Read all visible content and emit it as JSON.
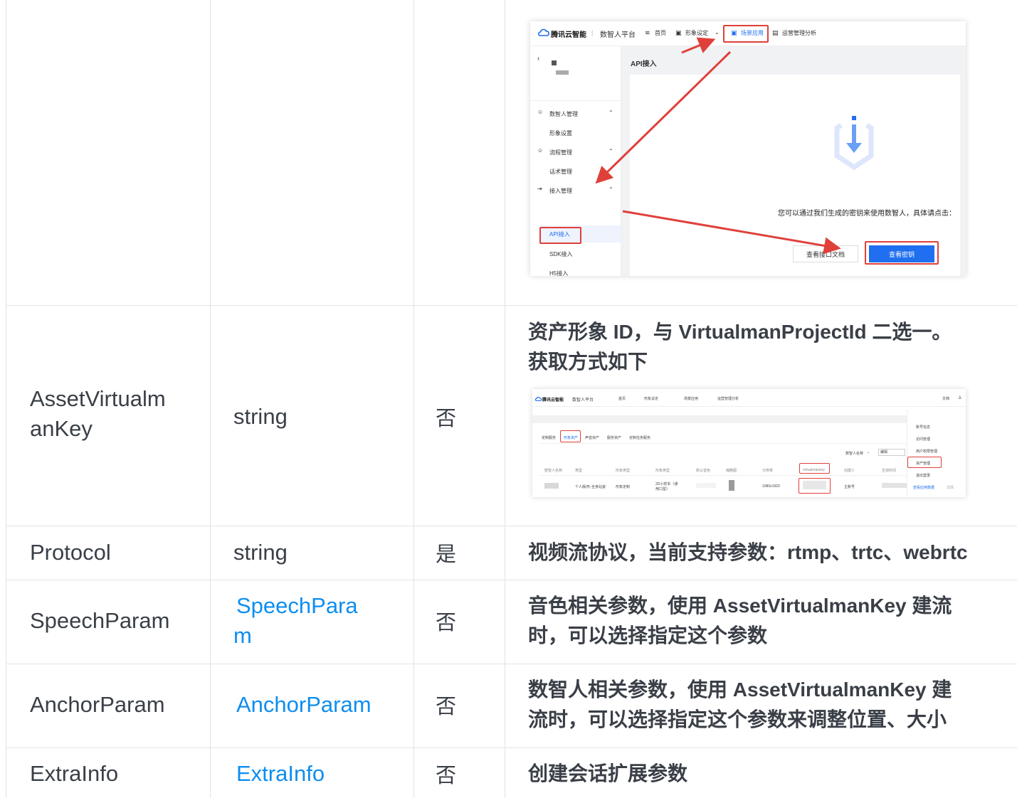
{
  "table": {
    "rows": [
      {
        "name_lines": [
          "AssetVirtualm",
          "anKey"
        ],
        "type": "string",
        "required": "否",
        "desc_lines": [
          "资产形象 ID，与 VirtualmanProjectId 二选一。",
          "获取方式如下"
        ]
      },
      {
        "name": "Protocol",
        "type": "string",
        "required": "是",
        "desc": "视频流协议，当前支持参数：rtmp、trtc、webrtc"
      },
      {
        "name": "SpeechParam",
        "type_lines": [
          "SpeechPara",
          "m"
        ],
        "required": "否",
        "desc_lines": [
          "音色相关参数，使用 AssetVirtualmanKey 建流",
          "时，可以选择指定这个参数"
        ]
      },
      {
        "name": "AnchorParam",
        "type": "AnchorParam",
        "required": "否",
        "desc_lines": [
          "数智人相关参数，使用 AssetVirtualmanKey 建",
          "流时，可以选择指定这个参数来调整位置、大小"
        ]
      },
      {
        "name": "ExtraInfo",
        "type": "ExtraInfo",
        "required": "否",
        "desc": "创建会话扩展参数"
      }
    ]
  },
  "shot1": {
    "brand": "腾讯云智能",
    "platform": "数智人平台",
    "nav": [
      "首页",
      "形象设定",
      "场景应用",
      "运营管理分析"
    ],
    "page_title": "API接入",
    "menu": [
      {
        "label": "数智人管理",
        "sub": [
          "形象设置"
        ]
      },
      {
        "label": "流程管理",
        "sub": [
          "话术管理"
        ]
      },
      {
        "label": "接入管理",
        "sub": [
          "API接入",
          "SDK接入",
          "H5接入"
        ]
      }
    ],
    "hint": "您可以通过我们生成的密钥来使用数智人，具体请点击：",
    "btn_doc": "查看接口文档",
    "btn_key": "查看密钥",
    "accent": "#1f6ff0",
    "arrow_color": "#e0403a"
  },
  "shot2": {
    "brand": "腾讯云智能",
    "platform": "数智人平台",
    "nav": [
      "首页",
      "形象设定",
      "场景应用",
      "运营管理分析"
    ],
    "top_right": [
      "文档"
    ],
    "tabs": [
      "定制服务",
      "形象资产",
      "声音资产",
      "服务资产",
      "定制任务服务"
    ],
    "filter_label": "数智人名称",
    "filter_value": "编辑",
    "columns": [
      "数智人名称",
      "类型",
      "形象类型",
      "形象类型",
      "默认音色",
      "缩略图",
      "分辨率",
      "virtualmankey",
      "创建人",
      "生效时间"
    ],
    "row": [
      "个人版/形-全身站姿",
      "形象定制",
      "2D小样本（通用口型）",
      "1080x1920",
      "主账号"
    ],
    "user_menu": [
      "账号信息",
      "访问管理",
      "用户权限管理",
      "资产管理",
      "退出登录"
    ],
    "footer_link": "查看应用数据",
    "footer_link2": "详情"
  }
}
